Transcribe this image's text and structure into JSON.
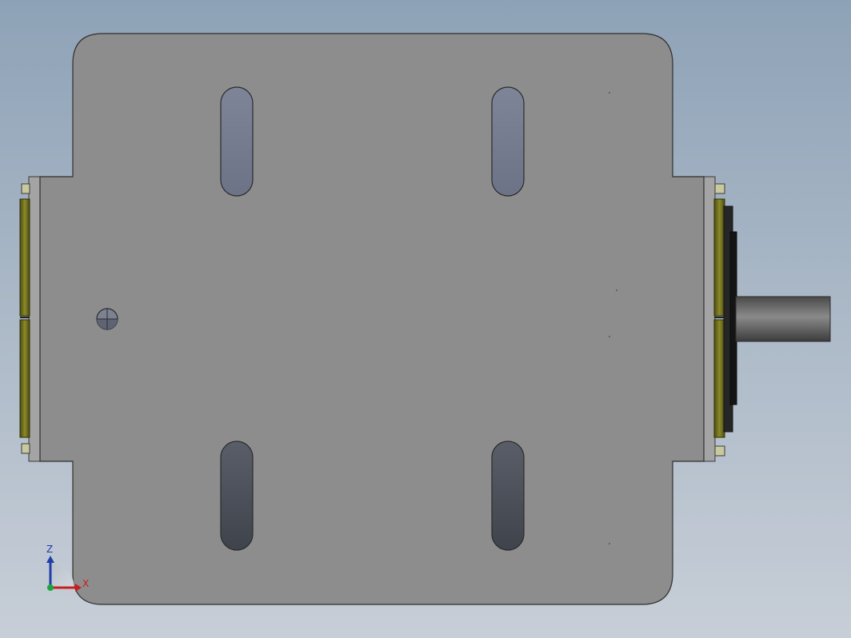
{
  "viewport": {
    "background_top": "#8ea2b7",
    "background_bottom": "#c7ced7"
  },
  "model": {
    "plate_color": "#8d8d8d",
    "slot_color_top": "#7a8193",
    "slot_color_bottom": "#4e525c",
    "flange_color": "#a7a7a7",
    "bearing_color": "#6b6b1a",
    "shaft_color": "#6f6f6f",
    "hub_color": "#1c1c1c"
  },
  "triad": {
    "z_label": "Z",
    "x_label": "X",
    "z_color": "#1e3fa8",
    "x_color": "#c81e1e",
    "origin_color": "#1aa63a"
  }
}
